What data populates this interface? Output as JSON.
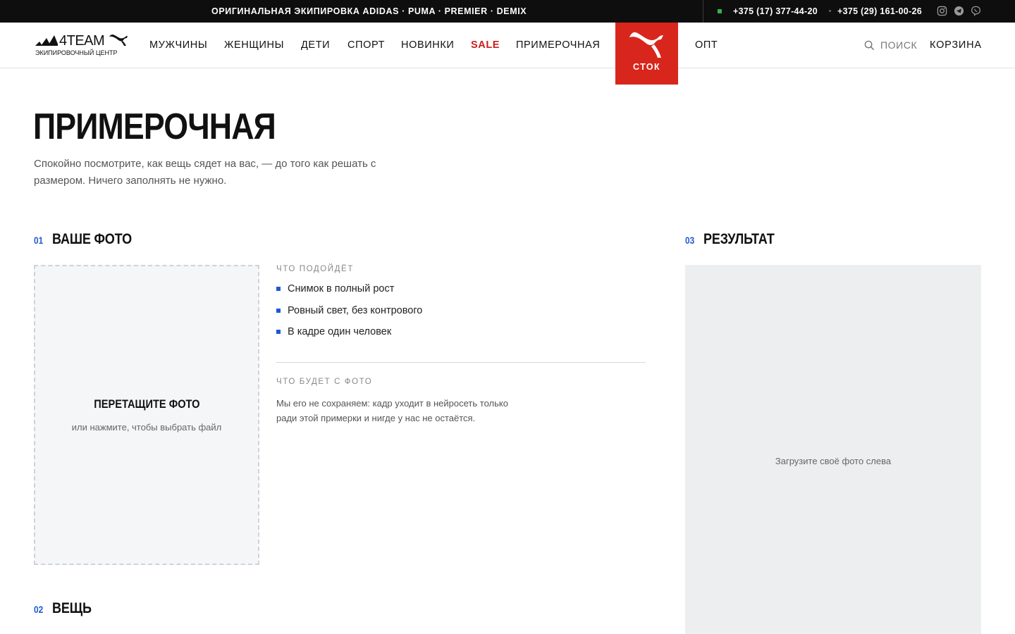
{
  "topbar": {
    "tagline": "ОРИГИНАЛЬНАЯ ЭКИПИРОВКА ADIDAS · PUMA · PREMIER · DEMIX",
    "phone1": "+375 (17) 377-44-20",
    "phone2": "+375 (29) 161-00-26",
    "socials": [
      "instagram-icon",
      "telegram-icon",
      "viber-icon"
    ]
  },
  "header": {
    "logo": {
      "brand": "4TEAM",
      "subtitle": "ЭКИПИРОВОЧНЫЙ ЦЕНТР"
    },
    "nav": [
      {
        "label": "МУЖЧИНЫ"
      },
      {
        "label": "ЖЕНЩИНЫ"
      },
      {
        "label": "ДЕТИ"
      },
      {
        "label": "СПОРТ"
      },
      {
        "label": "НОВИНКИ"
      },
      {
        "label": "SALE"
      },
      {
        "label": "ПРИМЕРОЧНАЯ"
      }
    ],
    "stock_label": "СТОК",
    "opt_label": "ОПТ",
    "search_label": "ПОИСК",
    "cart_label": "КОРЗИНА",
    "accent_color": "#d9261c"
  },
  "page": {
    "title": "ПРИМЕРОЧНАЯ",
    "lead": "Спокойно посмотрите, как вещь сядет на вас, — до того как решать с размером. Ничего заполнять не нужно."
  },
  "sections": {
    "photo": {
      "num": "01",
      "title": "ВАШЕ ФОТО"
    },
    "item": {
      "num": "02",
      "title": "ВЕЩЬ"
    },
    "result": {
      "num": "03",
      "title": "РЕЗУЛЬТАТ"
    }
  },
  "dropzone": {
    "title": "ПЕРЕТАЩИТЕ ФОТО",
    "subtitle": "или нажмите, чтобы выбрать файл"
  },
  "info": {
    "fit_caption": "ЧТО ПОДОЙДЁТ",
    "fit_items": [
      "Снимок в полный рост",
      "Ровный свет, без контрового",
      "В кадре один человек"
    ],
    "privacy_caption": "ЧТО БУДЕТ С ФОТО",
    "privacy_text": "Мы его не сохраняем: кадр уходит в нейросеть только ради этой примерки и нигде у нас не остаётся."
  },
  "result": {
    "hint": "Загрузите своё фото слева"
  }
}
